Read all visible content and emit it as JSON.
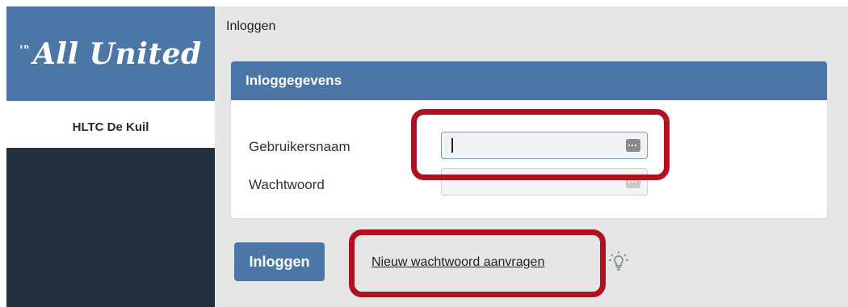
{
  "sidebar": {
    "logo_text": "All United",
    "logo_mark": "ᶦⁿ",
    "club_name": "HLTC De Kuil"
  },
  "main": {
    "page_title": "Inloggen",
    "panel_title": "Inloggegevens",
    "username_label": "Gebruikersnaam",
    "username_value": "",
    "password_label": "Wachtwoord",
    "password_value": "",
    "login_button": "Inloggen",
    "forgot_link": "Nieuw wachtwoord aanvragen"
  },
  "colors": {
    "brand_blue": "#4b76a5",
    "sidebar_dark": "#222f3d",
    "highlight_red": "#b01020"
  },
  "icons": [
    "keyboard-icon",
    "lightbulb-icon"
  ]
}
